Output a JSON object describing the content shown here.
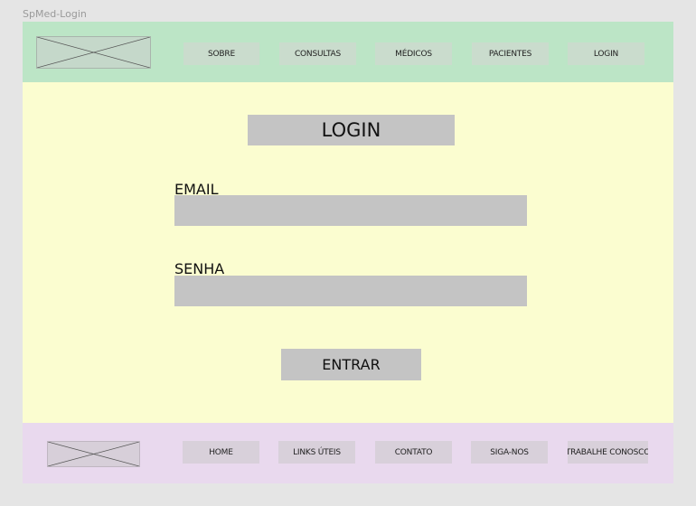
{
  "frame": {
    "title": "SpMed-Login"
  },
  "header": {
    "logo": "logo-placeholder",
    "nav": [
      {
        "label": "SOBRE"
      },
      {
        "label": "CONSULTAS"
      },
      {
        "label": "MÉDICOS"
      },
      {
        "label": "PACIENTES"
      },
      {
        "label": "LOGIN"
      }
    ]
  },
  "main": {
    "title": "LOGIN",
    "email_label": "EMAIL",
    "email_value": "",
    "password_label": "SENHA",
    "password_value": "",
    "submit_label": "ENTRAR"
  },
  "footer": {
    "logo": "logo-placeholder",
    "links": [
      {
        "label": "HOME"
      },
      {
        "label": "LINKS ÚTEIS"
      },
      {
        "label": "CONTATO"
      },
      {
        "label": "SIGA-NOS"
      },
      {
        "label": "TRABALHE CONOSCO"
      }
    ]
  },
  "colors": {
    "header_bg": "#bce5c6",
    "main_bg": "#fbfdd0",
    "footer_bg": "#e9d9ee",
    "block_gray": "#c4c4c4"
  }
}
